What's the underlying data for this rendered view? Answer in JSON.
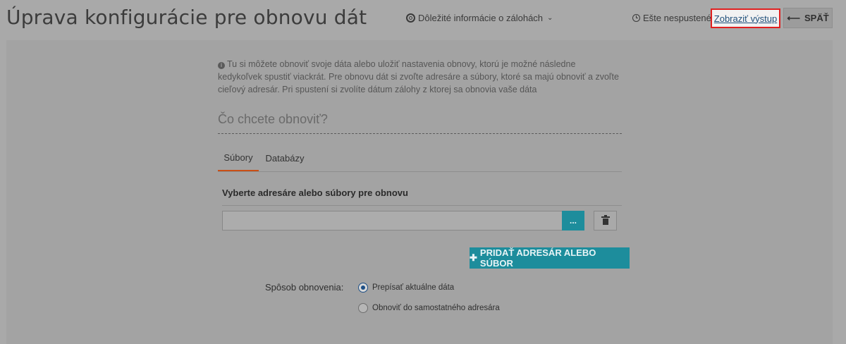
{
  "header": {
    "title": "Úprava konfigurácie pre obnovu dát",
    "info_dropdown_label": "Dôležité informácie o zálohách",
    "status_text": "Ešte nespustené",
    "show_output_label": "Zobraziť výstup",
    "back_label": "SPÄŤ"
  },
  "intro": {
    "text": "Tu si môžete obnoviť svoje dáta alebo uložiť nastavenia obnovy, ktorú je možné následne kedykoľvek spustiť viackrát. Pre obnovu dát si zvoľte adresáre a súbory, ktoré sa majú obnoviť a zvoľte cieľový adresár. Pri spustení si zvolíte dátum zálohy z ktorej sa obnovia vaše dáta"
  },
  "section": {
    "heading": "Čo chcete obnoviť?"
  },
  "tabs": [
    {
      "label": "Súbory",
      "active": true
    },
    {
      "label": "Databázy",
      "active": false
    }
  ],
  "files": {
    "label": "Vyberte adresáre alebo súbory pre obnovu",
    "path_value": "",
    "browse_label": "...",
    "add_label": "PRIDAŤ ADRESÁR ALEBO SÚBOR"
  },
  "restore_method": {
    "label": "Spôsob obnovenia:",
    "options": [
      {
        "label": "Prepísať aktuálne dáta",
        "checked": true
      },
      {
        "label": "Obnoviť do samostatného adresára",
        "checked": false
      }
    ]
  },
  "icons": {
    "info_dropdown": "lifebuoy-icon",
    "status": "clock-icon",
    "back": "arrow-left-icon",
    "intro": "info-circle-icon",
    "delete": "trash-icon",
    "add": "plus-icon"
  },
  "colors": {
    "accent_teal": "#1d8d9c",
    "active_tab_underline": "#c94f16",
    "highlight_border": "#e02020",
    "link": "#1f4f7a",
    "radio_checked": "#1d4f86"
  }
}
